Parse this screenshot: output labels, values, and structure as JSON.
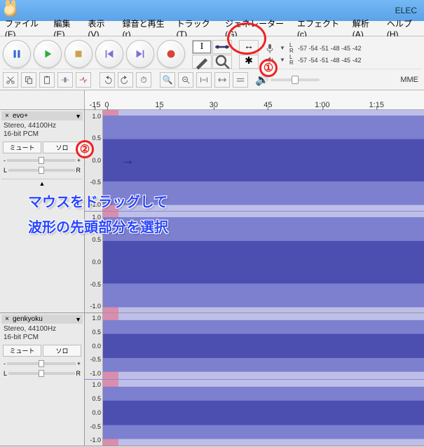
{
  "window": {
    "title": "ELEC"
  },
  "menu": {
    "file": "ファイル(F)",
    "edit": "編集(E)",
    "view": "表示(V)",
    "record": "録音と再生(r)",
    "track": "トラック(T)",
    "generator": "ジェネレーター(G)",
    "effect": "エフェクト(c)",
    "analyze": "解析(A)",
    "help": "ヘルプ(H)"
  },
  "meter": {
    "scale": "-57 -54 -51 -48 -45 -42",
    "L": "L",
    "R": "R"
  },
  "device": {
    "host": "MME"
  },
  "timeline": {
    "labels": [
      "-15",
      "0",
      "15",
      "30",
      "45",
      "1:00",
      "1:15"
    ]
  },
  "tracks": [
    {
      "close": "×",
      "name": "evo+",
      "dd": "▼",
      "format_line1": "Stereo, 44100Hz",
      "format_line2": "16-bit PCM",
      "mute": "ミュート",
      "solo": "ソロ",
      "gain_minus": "-",
      "gain_plus": "+",
      "pan_L": "L",
      "pan_R": "R",
      "expand": "▲",
      "axis": {
        "p1": "1.0",
        "p05": "0.5",
        "z": "0.0",
        "n05": "-0.5",
        "n1": "-1.0"
      }
    },
    {
      "close": "×",
      "name": "genkyoku",
      "dd": "▼",
      "format_line1": "Stereo, 44100Hz",
      "format_line2": "16-bit PCM",
      "mute": "ミュート",
      "solo": "ソロ",
      "gain_minus": "-",
      "gain_plus": "+",
      "pan_L": "L",
      "pan_R": "R",
      "axis": {
        "p1": "1.0",
        "p05": "0.5",
        "z": "0.0",
        "n05": "-0.5",
        "n1": "-1.0"
      }
    }
  ],
  "annotations": {
    "num1": "①",
    "num2": "②",
    "arrow": "→",
    "line1": "マウスをドラッグして",
    "line2": "波形の先頭部分を選択"
  }
}
